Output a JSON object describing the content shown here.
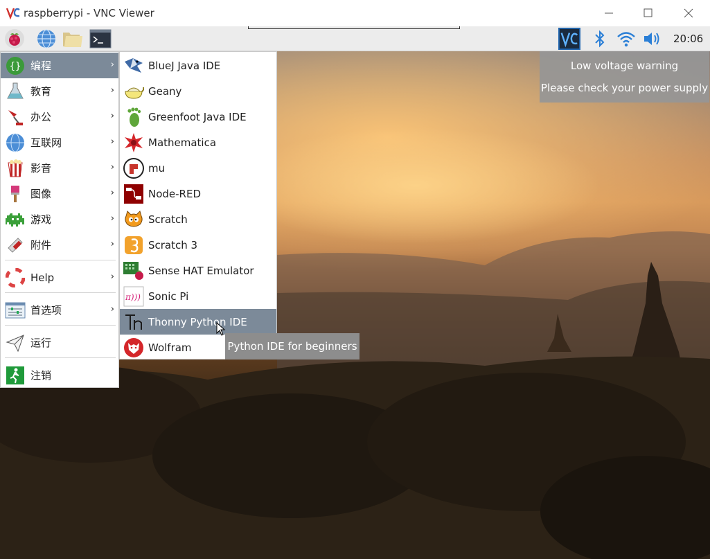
{
  "window": {
    "title": "raspberrypi - VNC Viewer"
  },
  "panel": {
    "clock": "20:06",
    "launchers": [
      "raspberry-menu",
      "web-browser",
      "file-manager",
      "terminal"
    ],
    "tray": [
      "vnc-server",
      "bluetooth",
      "wifi",
      "volume"
    ]
  },
  "main_menu": {
    "items": [
      {
        "label": "编程",
        "icon": "programming-icon",
        "has_submenu": true,
        "active": true
      },
      {
        "label": "教育",
        "icon": "education-icon",
        "has_submenu": true
      },
      {
        "label": "办公",
        "icon": "office-icon",
        "has_submenu": true
      },
      {
        "label": "互联网",
        "icon": "internet-icon",
        "has_submenu": true
      },
      {
        "label": "影音",
        "icon": "sound-video-icon",
        "has_submenu": true
      },
      {
        "label": "图像",
        "icon": "graphics-icon",
        "has_submenu": true
      },
      {
        "label": "游戏",
        "icon": "games-icon",
        "has_submenu": true
      },
      {
        "label": "附件",
        "icon": "accessories-icon",
        "has_submenu": true
      },
      {
        "label": "Help",
        "icon": "help-icon",
        "has_submenu": true
      },
      {
        "label": "首选项",
        "icon": "preferences-icon",
        "has_submenu": true
      },
      {
        "label": "运行",
        "icon": "run-icon",
        "has_submenu": false
      },
      {
        "label": "注销",
        "icon": "logout-icon",
        "has_submenu": false
      }
    ]
  },
  "submenu": {
    "items": [
      {
        "label": "BlueJ Java IDE",
        "icon": "bluej-icon"
      },
      {
        "label": "Geany",
        "icon": "geany-icon"
      },
      {
        "label": "Greenfoot Java IDE",
        "icon": "greenfoot-icon"
      },
      {
        "label": "Mathematica",
        "icon": "mathematica-icon"
      },
      {
        "label": "mu",
        "icon": "mu-icon"
      },
      {
        "label": "Node-RED",
        "icon": "node-red-icon"
      },
      {
        "label": "Scratch",
        "icon": "scratch-icon"
      },
      {
        "label": "Scratch 3",
        "icon": "scratch3-icon"
      },
      {
        "label": "Sense HAT Emulator",
        "icon": "sense-hat-icon"
      },
      {
        "label": "Sonic Pi",
        "icon": "sonic-pi-icon"
      },
      {
        "label": "Thonny Python IDE",
        "icon": "thonny-icon",
        "active": true
      },
      {
        "label": "Wolfram",
        "icon": "wolfram-icon"
      }
    ]
  },
  "tooltip": "Python IDE for beginners",
  "notification": {
    "line1": "Low voltage warning",
    "line2": "Please check your power supply"
  },
  "colors": {
    "highlight": "#7c8a99",
    "panel": "#ececec",
    "tooltip": "#8d8d8d",
    "notification": "#969696"
  }
}
